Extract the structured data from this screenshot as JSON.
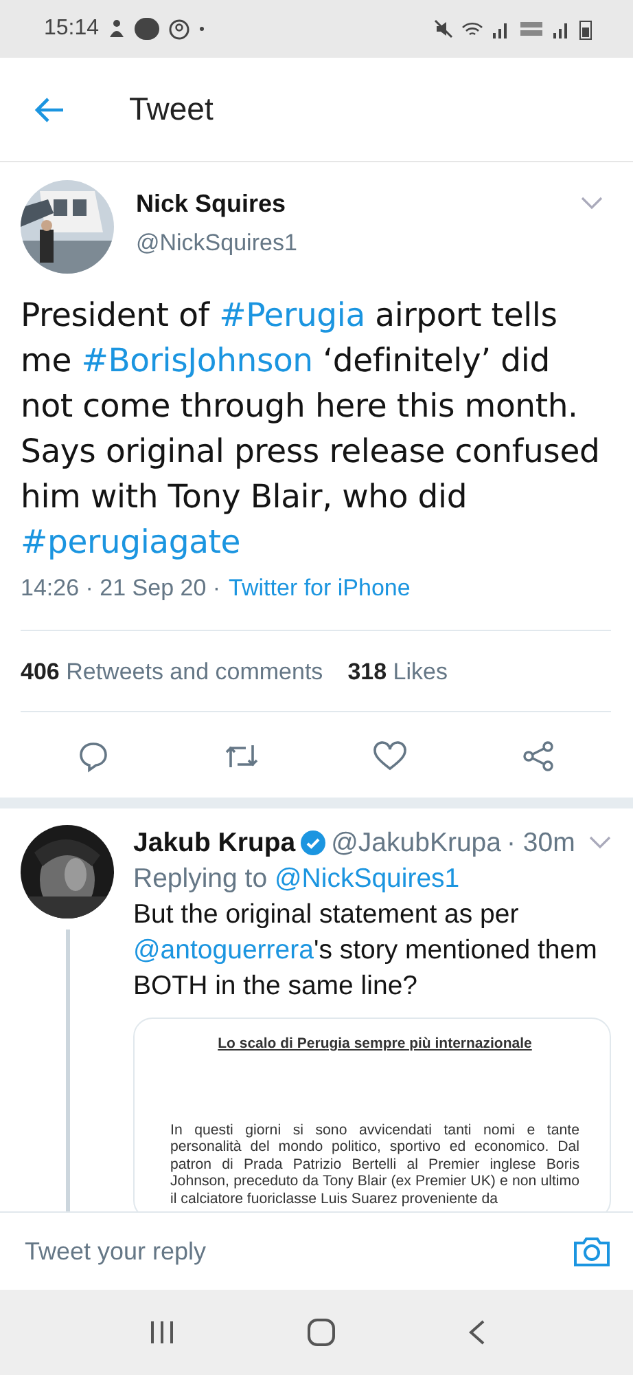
{
  "status_bar": {
    "time": "15:14"
  },
  "header": {
    "title": "Tweet"
  },
  "tweet": {
    "name": "Nick Squires",
    "handle": "@NickSquires1",
    "text": [
      {
        "kind": "plain",
        "text": "President of "
      },
      {
        "kind": "hashtag",
        "text": "#Perugia"
      },
      {
        "kind": "plain",
        "text": " airport tells me "
      },
      {
        "kind": "hashtag",
        "text": "#BorisJohnson"
      },
      {
        "kind": "plain",
        "text": " ‘definitely’ did not come through here this month. Says original press release confused him with Tony Blair, who did "
      },
      {
        "kind": "hashtag",
        "text": "#perugiagate"
      }
    ],
    "timestamp": "14:26 · 21 Sep 20 ·",
    "source": "Twitter for iPhone",
    "stats": [
      {
        "count": "406",
        "label": "Retweets and comments"
      },
      {
        "count": "318",
        "label": "Likes"
      }
    ]
  },
  "reply": {
    "name": "Jakub Krupa",
    "verified": true,
    "handle": "@JakubKrupa",
    "time": "· 30m",
    "replying_prefix": "Replying to",
    "replying_to": "@NickSquires1",
    "text": [
      {
        "kind": "plain",
        "text": "But the original statement as per "
      },
      {
        "kind": "mention",
        "text": "@antoguerrera"
      },
      {
        "kind": "plain",
        "text": "'s story mentioned them BOTH in the same line?"
      }
    ],
    "attachment": {
      "title": "Lo scalo di Perugia sempre più internazionale",
      "body": "In questi giorni si sono avvicendati tanti nomi e tante personalità del mondo politico, sportivo ed economico. Dal patron di Prada Patrizio Bertelli al Premier inglese Boris Johnson, preceduto da Tony Blair (ex Premier UK) e non ultimo il calciatore fuoriclasse Luis Suarez proveniente da"
    }
  },
  "composer": {
    "placeholder": "Tweet your reply"
  }
}
